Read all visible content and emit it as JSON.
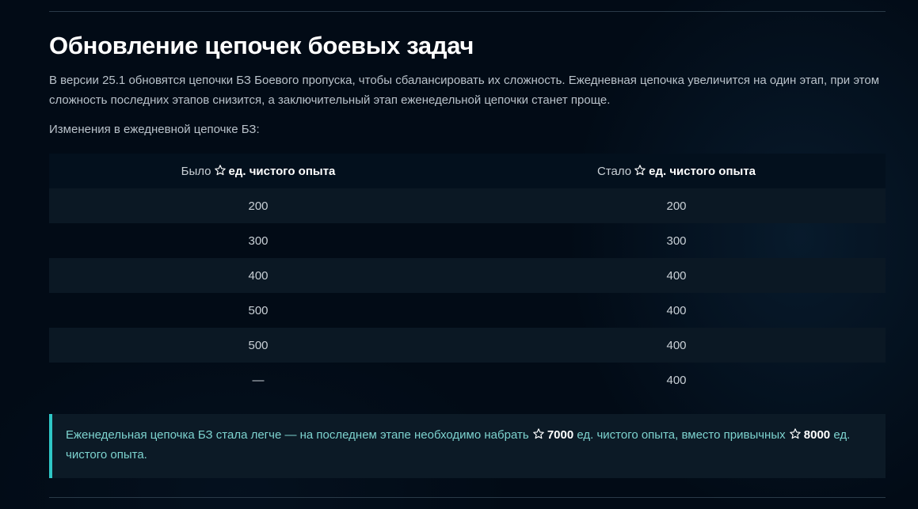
{
  "title": "Обновление цепочек боевых задач",
  "intro": "В версии 25.1 обновятся цепочки БЗ Боевого пропуска, чтобы сбалансировать их сложность. Ежедневная цепочка увеличится на один этап, при этом сложность последних этапов снизится, а заключительный этап еженедельной цепочки станет проще.",
  "lead": "Изменения в ежедневной цепочке БЗ:",
  "table": {
    "col_before_label": "Было",
    "col_after_label": "Стало",
    "unit_label": "ед. чистого опыта",
    "icon": "star-outline-icon",
    "rows": [
      {
        "before": "200",
        "after": "200"
      },
      {
        "before": "300",
        "after": "300"
      },
      {
        "before": "400",
        "after": "400"
      },
      {
        "before": "500",
        "after": "400"
      },
      {
        "before": "500",
        "after": "400"
      },
      {
        "before": "—",
        "after": "400"
      }
    ]
  },
  "note": {
    "text_1": "Еженедельная цепочка БЗ стала легче — на последнем этапе необходимо набрать ",
    "value_new": "7000",
    "text_2": " ед. чистого опыта, вместо привычных ",
    "value_old": "8000",
    "text_3": " ед. чистого опыта.",
    "accent_color": "#2ec6c6",
    "text_color": "#7dd3cf"
  }
}
